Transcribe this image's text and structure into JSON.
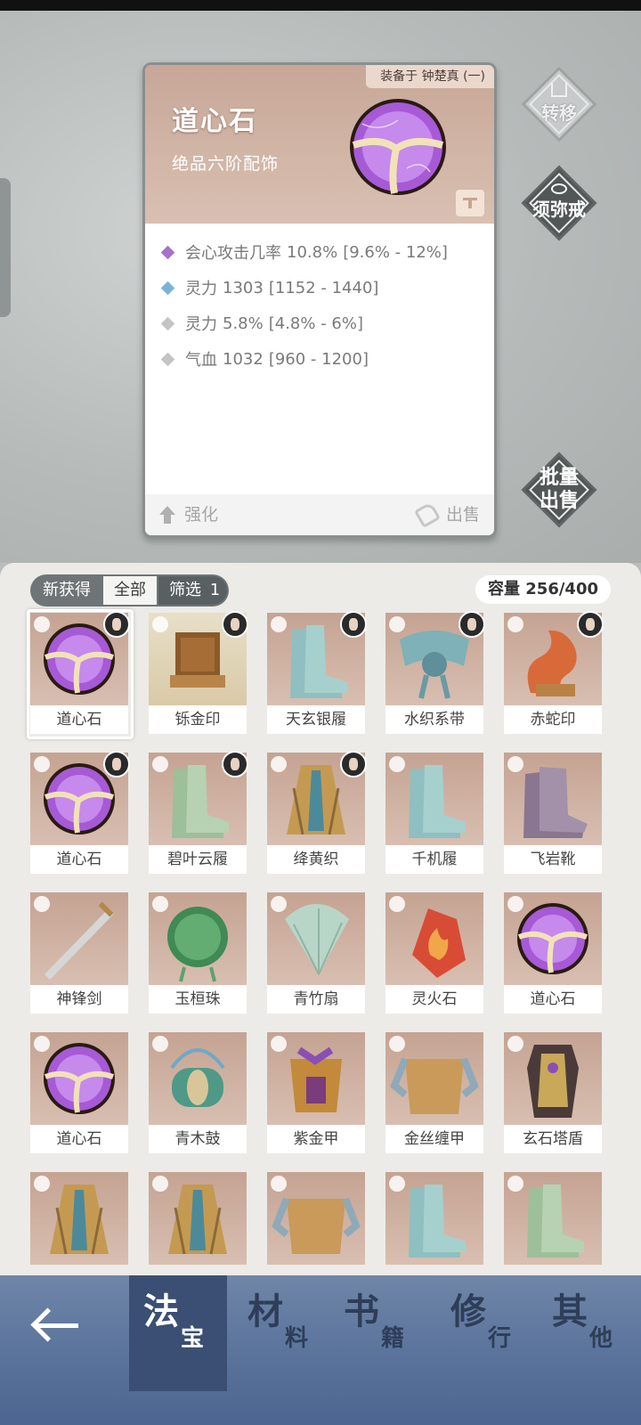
{
  "detail": {
    "equipped_on": "装备于 钟楚真 (一)",
    "name": "道心石",
    "subtitle": "绝品六阶配饰",
    "stats": [
      {
        "label": "会心攻击几率",
        "value": "10.8%",
        "range": "[9.6% - 12%]",
        "color": "#a472c8"
      },
      {
        "label": "灵力",
        "value": "1303",
        "range": "[1152 - 1440]",
        "color": "#79b4d8"
      },
      {
        "label": "灵力",
        "value": "5.8%",
        "range": "[4.8% - 6%]",
        "color": "#c4c4c4"
      },
      {
        "label": "气血",
        "value": "1032",
        "range": "[960 - 1200]",
        "color": "#c4c4c4"
      }
    ],
    "strengthen_label": "强化",
    "sell_label": "出售"
  },
  "side_buttons": {
    "transfer": "转移",
    "sumeru": "须弥戒",
    "batch_sell_line1": "批量",
    "batch_sell_line2": "出售"
  },
  "inventory": {
    "filters": {
      "new": "新获得",
      "all": "全部",
      "filter": "筛选",
      "filter_count": "1"
    },
    "capacity": "容量 256/400",
    "items": [
      {
        "name": "道心石",
        "art": "orb"
      },
      {
        "name": "铄金印",
        "art": "seal"
      },
      {
        "name": "天玄银履",
        "art": "boots-teal"
      },
      {
        "name": "水织系带",
        "art": "belt"
      },
      {
        "name": "赤蛇印",
        "art": "snake"
      },
      {
        "name": "道心石",
        "art": "orb"
      },
      {
        "name": "碧叶云履",
        "art": "boots-green"
      },
      {
        "name": "绛黄织",
        "art": "robe"
      },
      {
        "name": "千机履",
        "art": "boots-teal"
      },
      {
        "name": "飞岩靴",
        "art": "boots-purple"
      },
      {
        "name": "神锋剑",
        "art": "sword"
      },
      {
        "name": "玉桓珠",
        "art": "jade"
      },
      {
        "name": "青竹扇",
        "art": "fan"
      },
      {
        "name": "灵火石",
        "art": "fire"
      },
      {
        "name": "道心石",
        "art": "orb"
      },
      {
        "name": "道心石",
        "art": "orb"
      },
      {
        "name": "青木鼓",
        "art": "drum"
      },
      {
        "name": "紫金甲",
        "art": "armor-purple"
      },
      {
        "name": "金丝缠甲",
        "art": "armor-gold"
      },
      {
        "name": "玄石塔盾",
        "art": "shield"
      },
      {
        "name": "",
        "art": "robe"
      },
      {
        "name": "",
        "art": "robe"
      },
      {
        "name": "",
        "art": "armor-gold"
      },
      {
        "name": "",
        "art": "boots-teal"
      },
      {
        "name": "",
        "art": "boots-green"
      }
    ]
  },
  "nav": {
    "tabs": [
      {
        "main": "法",
        "sub": "宝"
      },
      {
        "main": "材",
        "sub": "料"
      },
      {
        "main": "书",
        "sub": "籍"
      },
      {
        "main": "修",
        "sub": "行"
      },
      {
        "main": "其",
        "sub": "他"
      }
    ]
  },
  "colors": {
    "accent_purple": "#a472c8",
    "nav_blue": "#58719a",
    "card_head": "#c7a797"
  }
}
